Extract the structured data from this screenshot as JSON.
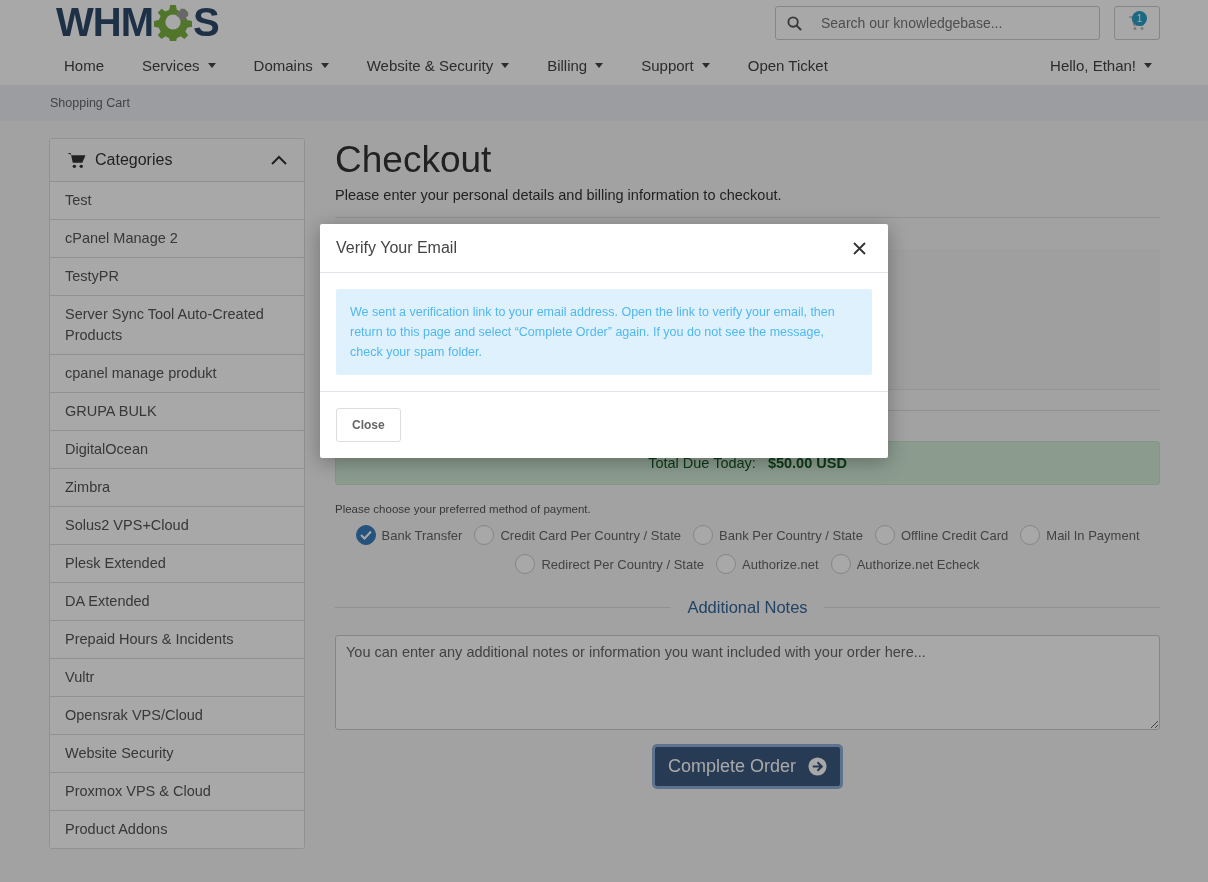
{
  "logo": {
    "before": "WHM",
    "after": "S"
  },
  "search": {
    "placeholder": "Search our knowledgebase..."
  },
  "cart": {
    "count": "1"
  },
  "nav": [
    {
      "label": "Home",
      "dropdown": false
    },
    {
      "label": "Services",
      "dropdown": true
    },
    {
      "label": "Domains",
      "dropdown": true
    },
    {
      "label": "Website & Security",
      "dropdown": true
    },
    {
      "label": "Billing",
      "dropdown": true
    },
    {
      "label": "Support",
      "dropdown": true
    },
    {
      "label": "Open Ticket",
      "dropdown": false
    }
  ],
  "user_menu": {
    "label": "Hello, Ethan!"
  },
  "breadcrumb": "Shopping Cart",
  "sidebar": {
    "title": "Categories",
    "expanded": true,
    "items": [
      {
        "label": "Test"
      },
      {
        "label": "cPanel Manage 2"
      },
      {
        "label": "TestyPR"
      },
      {
        "label": "Server Sync Tool Auto-Created Products"
      },
      {
        "label": "cpanel manage produkt"
      },
      {
        "label": "GRUPA BULK"
      },
      {
        "label": "DigitalOcean"
      },
      {
        "label": "Zimbra"
      },
      {
        "label": "Solus2 VPS+Cloud"
      },
      {
        "label": "Plesk Extended"
      },
      {
        "label": "DA Extended"
      },
      {
        "label": "Prepaid Hours & Incidents"
      },
      {
        "label": "Vultr"
      },
      {
        "label": "Opensrak VPS/Cloud"
      },
      {
        "label": "Website Security"
      },
      {
        "label": "Proxmox VPS & Cloud"
      },
      {
        "label": "Product Addons"
      }
    ]
  },
  "page": {
    "title": "Checkout",
    "subtitle": "Please enter your personal details and billing information to checkout."
  },
  "total": {
    "label": "Total Due Today:",
    "amount": "$50.00 USD"
  },
  "payment": {
    "prompt": "Please choose your preferred method of payment.",
    "methods": [
      {
        "label": "Bank Transfer",
        "selected": true
      },
      {
        "label": "Credit Card Per Country / State",
        "selected": false
      },
      {
        "label": "Bank Per Country / State",
        "selected": false
      },
      {
        "label": "Offline Credit Card",
        "selected": false
      },
      {
        "label": "Mail In Payment",
        "selected": false
      },
      {
        "label": "Redirect Per Country / State",
        "selected": false
      },
      {
        "label": "Authorize.net",
        "selected": false
      },
      {
        "label": "Authorize.net Echeck",
        "selected": false
      }
    ]
  },
  "notes": {
    "heading": "Additional Notes",
    "placeholder": "You can enter any additional notes or information you want included with your order here..."
  },
  "submit": {
    "label": "Complete Order"
  },
  "modal": {
    "title": "Verify Your Email",
    "message": "We sent a verification link to your email address. Open the link to verify your email, then return to this page and select “Complete Order” again. If you do not see the message, check your spam folder.",
    "close_button": "Close"
  }
}
